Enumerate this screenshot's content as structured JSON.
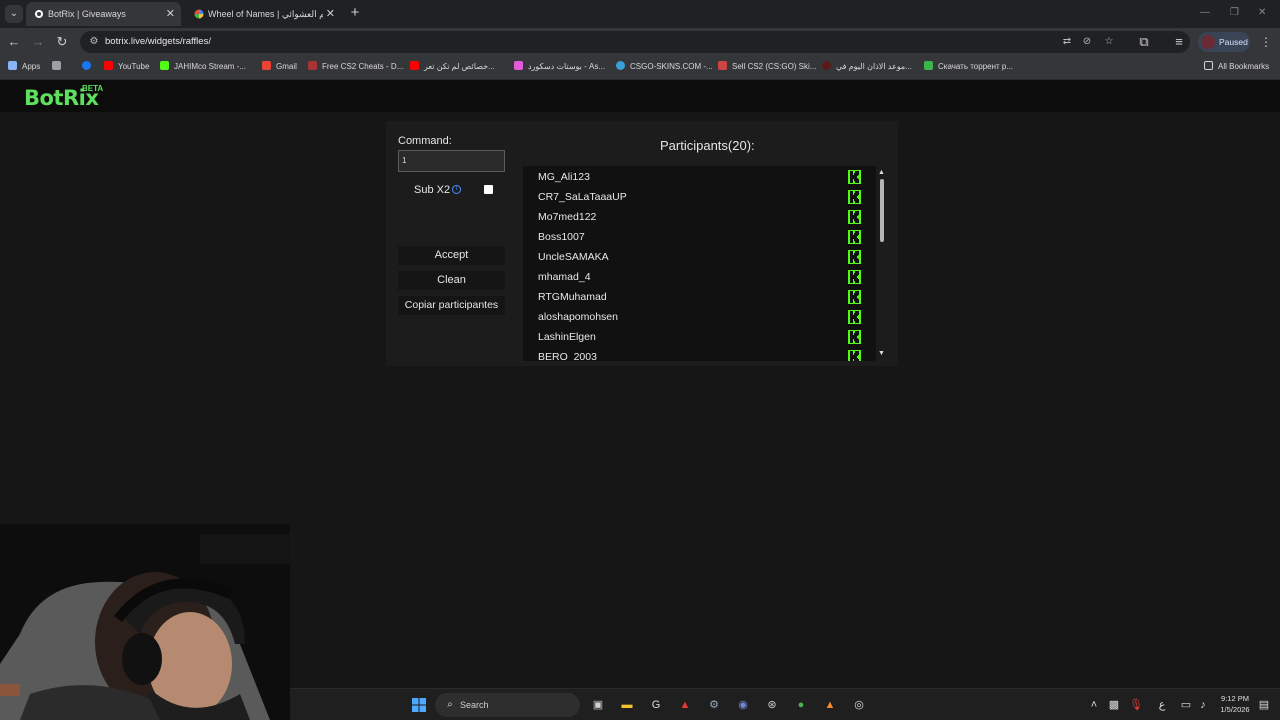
{
  "browser": {
    "tabs": [
      {
        "title": "BotRix | Giveaways",
        "active": true
      },
      {
        "title": "Wheel of Names | قسم العشوائي",
        "active": false
      }
    ],
    "url": "botrix.live/widgets/raffles/",
    "profile_status": "Paused",
    "bookmarks": [
      {
        "label": "Apps"
      },
      {
        "label": "YouTube"
      },
      {
        "label": "JAHIMco Stream -..."
      },
      {
        "label": "Gmail"
      },
      {
        "label": "Free CS2 Cheats - D..."
      },
      {
        "label": "خصائص لم تكن تعر..."
      },
      {
        "label": "بوستات دسكورد - As..."
      },
      {
        "label": "CSGO-SKINS.COM -..."
      },
      {
        "label": "Sell CS2 (CS:GO) Ski..."
      },
      {
        "label": "موعد الاذان اليوم في..."
      },
      {
        "label": "Скачать торрент р..."
      },
      {
        "label": "All Bookmarks"
      }
    ]
  },
  "app": {
    "logo": "BotRix",
    "beta": "BETA"
  },
  "raffle": {
    "command_label": "Command:",
    "command_value": "1",
    "sub_label": "Sub X2",
    "accept_label": "Accept",
    "clean_label": "Clean",
    "copy_label": "Copiar participantes",
    "participants_title": "Participants(20):",
    "participants": [
      "MG_Ali123",
      "CR7_SaLaTaaaUP",
      "Mo7med122",
      "Boss1007",
      "UncleSAMAKA",
      "mhamad_4",
      "RTGMuhamad",
      "aloshapomohsen",
      "LashinElgen",
      "BERO_2003"
    ]
  },
  "taskbar": {
    "search_label": "Search",
    "time": "9:12 PM",
    "date": "1/5/2026",
    "lang": "ع"
  },
  "colors": {
    "accent": "#5ee05e",
    "kick_green": "#53fc18",
    "page_bg": "#161616",
    "panel_bg": "#1c1c1c"
  }
}
